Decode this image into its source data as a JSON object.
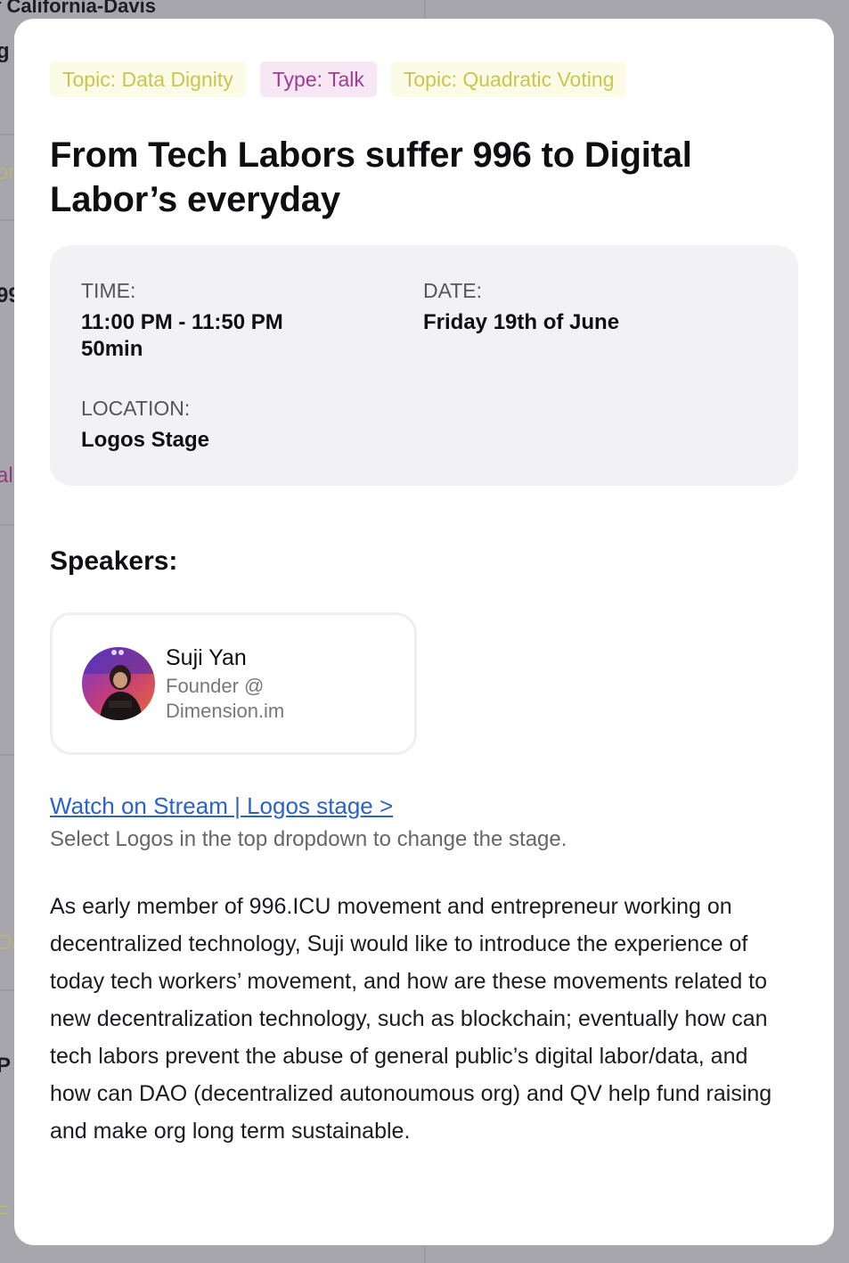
{
  "background": {
    "org_fragment": "f California-Davis",
    "fragments": [
      "g",
      "or",
      "99",
      "alk",
      "Di",
      "P",
      "F"
    ]
  },
  "modal": {
    "tags": [
      {
        "label": "Topic: Data Dignity",
        "kind": "topic"
      },
      {
        "label": "Type: Talk",
        "kind": "type"
      },
      {
        "label": "Topic: Quadratic Voting",
        "kind": "topic"
      }
    ],
    "title": "From Tech Labors suffer 996 to Digital Labor’s everyday",
    "info": {
      "time_label": "TIME:",
      "time_value": "11:00 PM - 11:50 PM",
      "duration": "50min",
      "date_label": "DATE:",
      "date_value": "Friday 19th of June",
      "location_label": "LOCATION:",
      "location_value": "Logos Stage"
    },
    "speakers_heading": "Speakers:",
    "speaker": {
      "name": "Suji Yan",
      "role_line1": "Founder @",
      "role_line2": "Dimension.im"
    },
    "stream_link": "Watch on Stream | Logos stage  >",
    "stream_note": "Select Logos in the top dropdown to change the stage.",
    "description": "As early member of 996.ICU movement and entrepreneur working on decentralized technology, Suji would like to introduce the experience of today tech workers’ movement, and how are these movements related to new decentralization technology, such as blockchain; eventually how can tech labors prevent the abuse of general public’s digital labor/data, and how can DAO (decentralized autonoumous org) and QV help fund raising and make org long term sustainable."
  },
  "colors": {
    "topic_tag_bg": "#fcfbe6",
    "topic_tag_text": "#c9c550",
    "type_tag_bg": "#f7e6f3",
    "type_tag_text": "#a23a92",
    "link": "#2c62c7",
    "overlay": "#a7a6ad"
  }
}
